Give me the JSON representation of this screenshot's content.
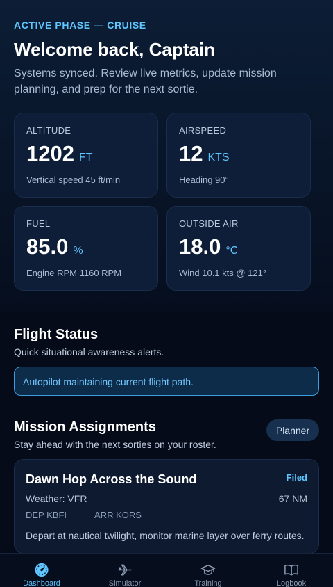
{
  "header": {
    "phase": "ACTIVE PHASE — CRUISE",
    "welcome": "Welcome back, Captain",
    "intro": "Systems synced. Review live metrics, update mission planning, and prep for the next sortie."
  },
  "metrics": [
    {
      "label": "ALTITUDE",
      "value": "1202",
      "unit": "FT",
      "sub": "Vertical speed 45 ft/min"
    },
    {
      "label": "AIRSPEED",
      "value": "12",
      "unit": "KTS",
      "sub": "Heading 90°"
    },
    {
      "label": "FUEL",
      "value": "85.0",
      "unit": "%",
      "sub": "Engine RPM 1160 RPM"
    },
    {
      "label": "OUTSIDE AIR",
      "value": "18.0",
      "unit": "°C",
      "sub": "Wind 10.1 kts @ 121°"
    }
  ],
  "flight_status": {
    "title": "Flight Status",
    "subtitle": "Quick situational awareness alerts.",
    "alert": "Autopilot maintaining current flight path."
  },
  "missions": {
    "title": "Mission Assignments",
    "subtitle": "Stay ahead with the next sorties on your roster.",
    "planner_label": "Planner",
    "card": {
      "title": "Dawn Hop Across the Sound",
      "status": "Filed",
      "weather": "Weather: VFR",
      "distance": "67 NM",
      "dep": "DEP KBFI",
      "arr": "ARR KORS",
      "description": "Depart at nautical twilight, monitor marine layer over ferry routes."
    }
  },
  "tabs": [
    {
      "label": "Dashboard",
      "icon": "gauge-icon",
      "active": true
    },
    {
      "label": "Simulator",
      "icon": "airplane-icon",
      "active": false
    },
    {
      "label": "Training",
      "icon": "graduation-cap-icon",
      "active": false
    },
    {
      "label": "Logbook",
      "icon": "book-icon",
      "active": false
    }
  ],
  "colors": {
    "accent": "#5fc6ff",
    "background": "#050b18",
    "card": "#0e1e38",
    "alert_border": "#3f9ee0"
  }
}
